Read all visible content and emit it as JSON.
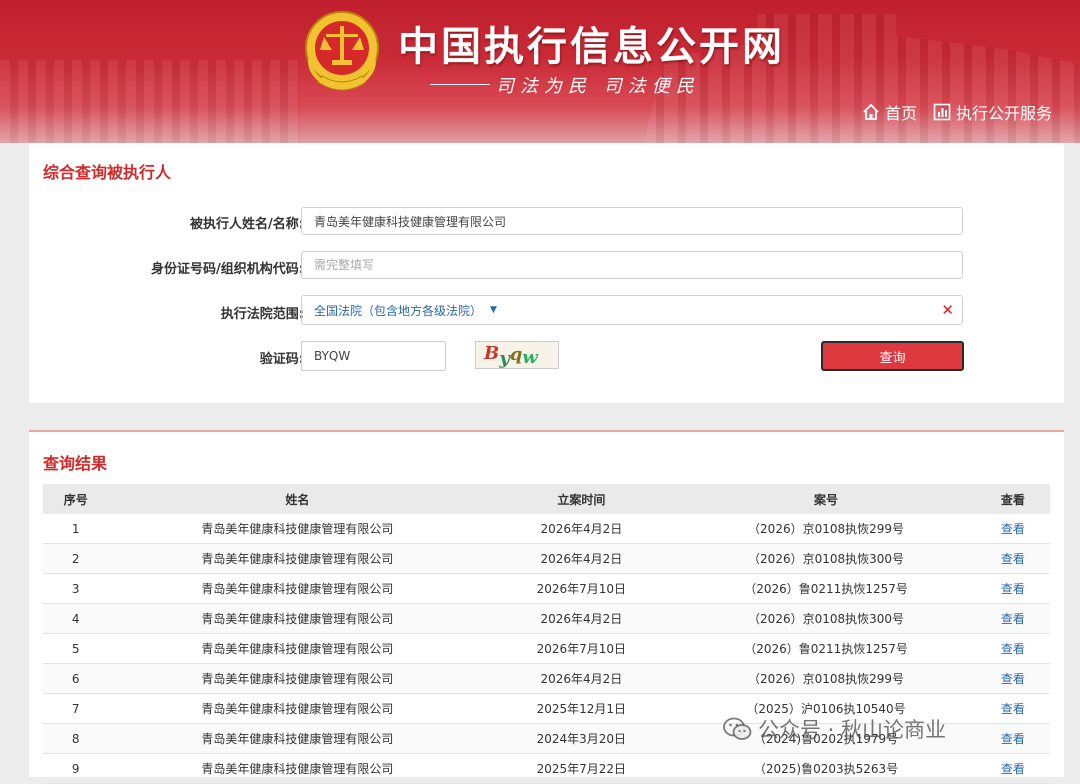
{
  "header": {
    "site_title": "中国执行信息公开网",
    "slogan": "司法为民 司法便民",
    "nav": [
      {
        "label": "首页",
        "icon": "home-icon"
      },
      {
        "label": "执行公开服务",
        "icon": "chart-icon"
      }
    ],
    "colors": {
      "banner": "#c92a36",
      "accent": "#d12a2a",
      "link": "#2a6aa8"
    }
  },
  "query_form": {
    "title": "综合查询被执行人",
    "name_label": "被执行人姓名/名称:",
    "name_value": "青岛美年健康科技健康管理有限公司",
    "id_label": "身份证号码/组织机构代码:",
    "id_placeholder": "需完整填写",
    "court_label": "执行法院范围:",
    "court_value": "全国法院（包含地方各级法院）",
    "captcha_label": "验证码:",
    "captcha_value": "BYQW",
    "captcha_image_text": [
      "B",
      "y",
      "q",
      "w"
    ],
    "submit_label": "查询"
  },
  "results": {
    "title": "查询结果",
    "columns": [
      "序号",
      "姓名",
      "立案时间",
      "案号",
      "查看"
    ],
    "rows": [
      {
        "seq": "1",
        "name": "青岛美年健康科技健康管理有限公司",
        "date": "2026年4月2日",
        "case": "（2026）京0108执恢299号",
        "view": "查看"
      },
      {
        "seq": "2",
        "name": "青岛美年健康科技健康管理有限公司",
        "date": "2026年4月2日",
        "case": "（2026）京0108执恢300号",
        "view": "查看"
      },
      {
        "seq": "3",
        "name": "青岛美年健康科技健康管理有限公司",
        "date": "2026年7月10日",
        "case": "（2026）鲁0211执恢1257号",
        "view": "查看"
      },
      {
        "seq": "4",
        "name": "青岛美年健康科技健康管理有限公司",
        "date": "2026年4月2日",
        "case": "（2026）京0108执恢300号",
        "view": "查看"
      },
      {
        "seq": "5",
        "name": "青岛美年健康科技健康管理有限公司",
        "date": "2026年7月10日",
        "case": "（2026）鲁0211执恢1257号",
        "view": "查看"
      },
      {
        "seq": "6",
        "name": "青岛美年健康科技健康管理有限公司",
        "date": "2026年4月2日",
        "case": "（2026）京0108执恢299号",
        "view": "查看"
      },
      {
        "seq": "7",
        "name": "青岛美年健康科技健康管理有限公司",
        "date": "2025年12月1日",
        "case": "（2025）沪0106执10540号",
        "view": "查看"
      },
      {
        "seq": "8",
        "name": "青岛美年健康科技健康管理有限公司",
        "date": "2024年3月20日",
        "case": "（2024)鲁0202执1979号",
        "view": "查看"
      },
      {
        "seq": "9",
        "name": "青岛美年健康科技健康管理有限公司",
        "date": "2025年7月22日",
        "case": "（2025)鲁0203执5263号",
        "view": "查看"
      }
    ]
  },
  "watermark": {
    "text": "公众号 · 秋山论商业",
    "icon": "wechat-icon"
  }
}
